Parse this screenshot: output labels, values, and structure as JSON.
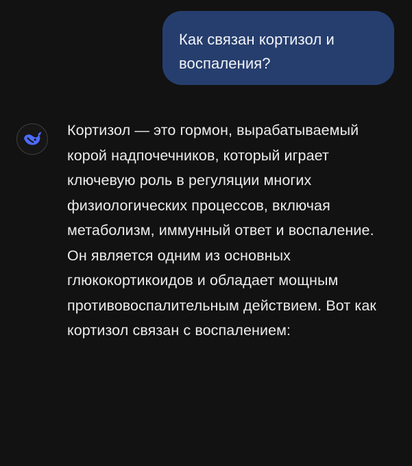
{
  "conversation": {
    "user_message": "Как связан кортизол и воспаления?",
    "assistant": {
      "avatar_icon": "deepseek-whale-icon",
      "avatar_color": "#4d6bfe",
      "message": "Кортизол — это гормон, вырабатываемый корой надпочечников, который играет ключевую роль в регуляции многих физиологических процессов, включая метаболизм, иммунный ответ и воспаление. Он является одним из основных глюкокортикоидов и обладает мощным противовоспалительным действием. Вот как кортизол связан с воспалением:"
    }
  },
  "colors": {
    "background": "#121212",
    "user_bubble": "#263e6e",
    "text": "#ececed"
  }
}
